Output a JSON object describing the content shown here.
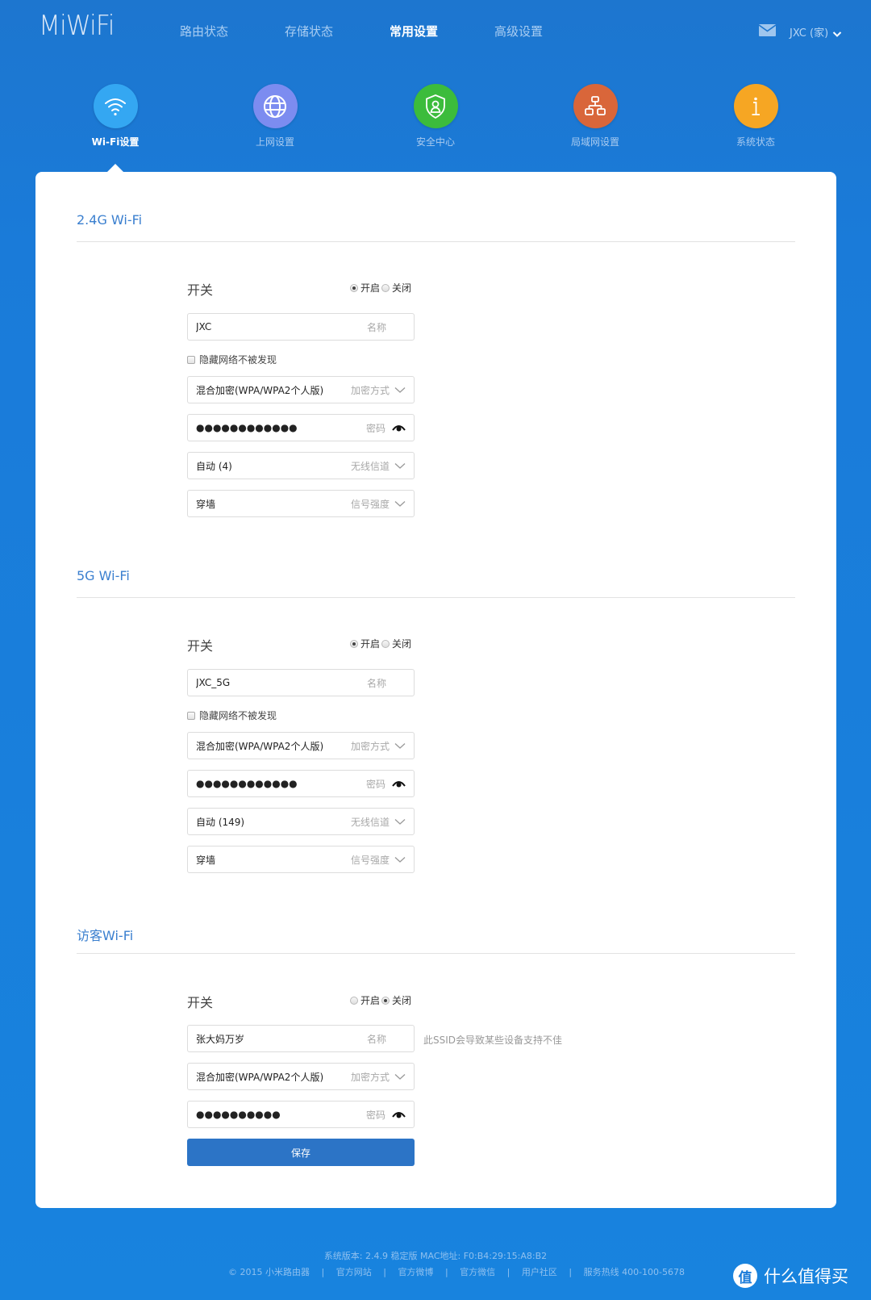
{
  "header": {
    "logo": "MiWiFi",
    "nav": [
      {
        "label": "路由状态",
        "active": false
      },
      {
        "label": "存储状态",
        "active": false
      },
      {
        "label": "常用设置",
        "active": true
      },
      {
        "label": "高级设置",
        "active": false
      }
    ],
    "mail_icon": "mail-icon",
    "user_label": "JXC (家)"
  },
  "categories": [
    {
      "label": "Wi-Fi设置",
      "icon": "wifi-icon",
      "color": "#34a7f2",
      "active": true
    },
    {
      "label": "上网设置",
      "icon": "globe-icon",
      "color": "#7c8cf0",
      "active": false
    },
    {
      "label": "安全中心",
      "icon": "shield-user-icon",
      "color": "#3cbc3c",
      "active": false
    },
    {
      "label": "局域网设置",
      "icon": "network-topology-icon",
      "color": "#d9663a",
      "active": false
    },
    {
      "label": "系统状态",
      "icon": "info-icon",
      "color": "#f6a623",
      "active": false
    }
  ],
  "sections": {
    "wifi24": {
      "title": "2.4G Wi-Fi",
      "switch_label": "开关",
      "on_label": "开启",
      "off_label": "关闭",
      "enabled": true,
      "ssid": "JXC",
      "ssid_hint": "名称",
      "hide_label": "隐藏网络不被发现",
      "hide_checked": false,
      "encryption": "混合加密(WPA/WPA2个人版)",
      "encryption_hint": "加密方式",
      "password": "●●●●●●●●●●●●",
      "password_hint": "密码",
      "channel": "自动 (4)",
      "channel_hint": "无线信道",
      "strength": "穿墙",
      "strength_hint": "信号强度"
    },
    "wifi5": {
      "title": "5G Wi-Fi",
      "switch_label": "开关",
      "on_label": "开启",
      "off_label": "关闭",
      "enabled": true,
      "ssid": "JXC_5G",
      "ssid_hint": "名称",
      "hide_label": "隐藏网络不被发现",
      "hide_checked": false,
      "encryption": "混合加密(WPA/WPA2个人版)",
      "encryption_hint": "加密方式",
      "password": "●●●●●●●●●●●●",
      "password_hint": "密码",
      "channel": "自动 (149)",
      "channel_hint": "无线信道",
      "strength": "穿墙",
      "strength_hint": "信号强度"
    },
    "guest": {
      "title": "访客Wi-Fi",
      "switch_label": "开关",
      "on_label": "开启",
      "off_label": "关闭",
      "enabled": false,
      "ssid": "张大妈万岁",
      "ssid_hint": "名称",
      "ssid_note": "此SSID会导致某些设备支持不佳",
      "encryption": "混合加密(WPA/WPA2个人版)",
      "encryption_hint": "加密方式",
      "password": "●●●●●●●●●●",
      "password_hint": "密码"
    }
  },
  "save_label": "保存",
  "footer": {
    "line1": "系统版本: 2.4.9 稳定版   MAC地址: F0:B4:29:15:A8:B2",
    "copyright": "© 2015 小米路由器",
    "links": [
      "官方网站",
      "官方微博",
      "官方微信",
      "用户社区"
    ],
    "hotline": "服务热线 400-100-5678",
    "separator": "|"
  },
  "watermark": {
    "logo_char": "值",
    "text": "什么值得买"
  }
}
